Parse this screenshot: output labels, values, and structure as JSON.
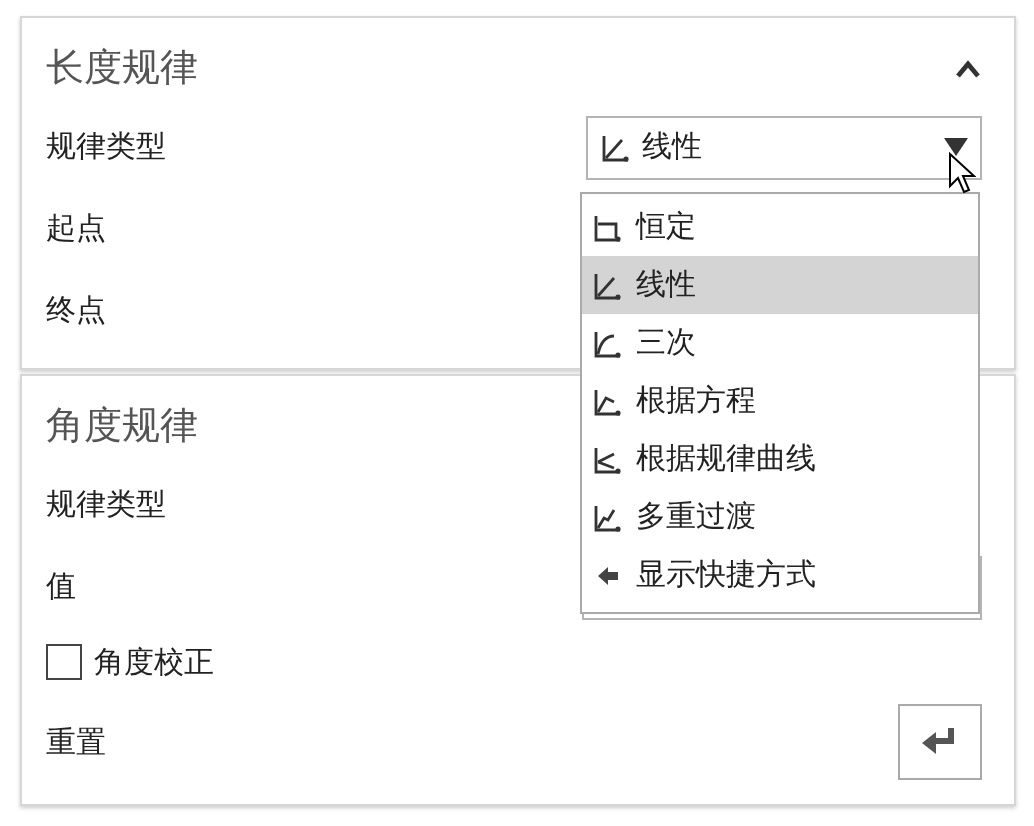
{
  "length_law": {
    "title": "长度规律",
    "expanded": true,
    "rows": [
      {
        "kind": "select",
        "label": "规律类型",
        "value": "线性"
      },
      {
        "kind": "plain",
        "label": "起点"
      },
      {
        "kind": "plain",
        "label": "终点"
      }
    ]
  },
  "angle_law": {
    "title": "角度规律",
    "rows": [
      {
        "kind": "plain",
        "label": "规律类型"
      },
      {
        "kind": "value",
        "label": "值"
      },
      {
        "kind": "checkbox",
        "label": "角度校正",
        "checked": false
      },
      {
        "kind": "reset",
        "label": "重置"
      }
    ]
  },
  "dropdown_menu": {
    "items": [
      {
        "kind": "law",
        "label": "恒定",
        "selected": false
      },
      {
        "kind": "law",
        "label": "线性",
        "selected": true
      },
      {
        "kind": "law",
        "label": "三次",
        "selected": false
      },
      {
        "kind": "law",
        "label": "根据方程",
        "selected": false
      },
      {
        "kind": "law",
        "label": "根据规律曲线",
        "selected": false
      },
      {
        "kind": "law",
        "label": "多重过渡",
        "selected": false
      },
      {
        "kind": "shortcut",
        "label": "显示快捷方式",
        "selected": false
      }
    ]
  }
}
